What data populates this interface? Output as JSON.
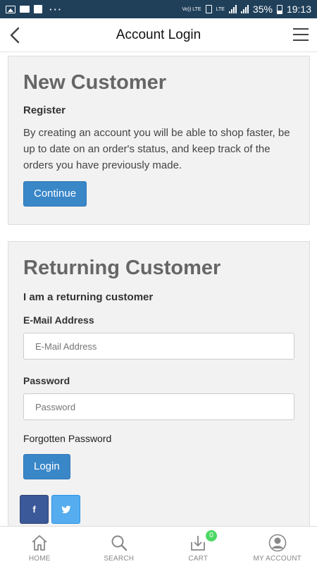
{
  "status_bar": {
    "left_icons": [
      "image-icon",
      "news-icon",
      "flipboard-icon"
    ],
    "more": "···",
    "volte": "Vo)) LTE",
    "lte": "LTE",
    "battery_percent": "35%",
    "time": "19:13"
  },
  "header": {
    "title": "Account Login",
    "back_icon": "back-arrow-icon",
    "menu_icon": "hamburger-menu-icon"
  },
  "new_customer": {
    "title": "New Customer",
    "subtitle": "Register",
    "description": "By creating an account you will be able to shop faster, be up to date on an order's status, and keep track of the orders you have previously made.",
    "button": "Continue"
  },
  "returning_customer": {
    "title": "Returning Customer",
    "subtitle": "I am a returning customer",
    "email_label": "E-Mail Address",
    "email_value": "",
    "email_placeholder": "E-Mail Address",
    "password_label": "Password",
    "password_value": "",
    "password_placeholder": "Password",
    "forgot": "Forgotten Password",
    "button": "Login"
  },
  "social": {
    "facebook": "f",
    "twitter": "t"
  },
  "bottom_nav": {
    "home": "HOME",
    "search": "SEARCH",
    "cart": "CART",
    "cart_count": "0",
    "account": "MY ACCOUNT"
  },
  "colors": {
    "status_bar": "#20405a",
    "primary_button": "#3a87c8",
    "facebook": "#3b5998",
    "twitter": "#55acee",
    "cart_badge": "#4cd964"
  }
}
